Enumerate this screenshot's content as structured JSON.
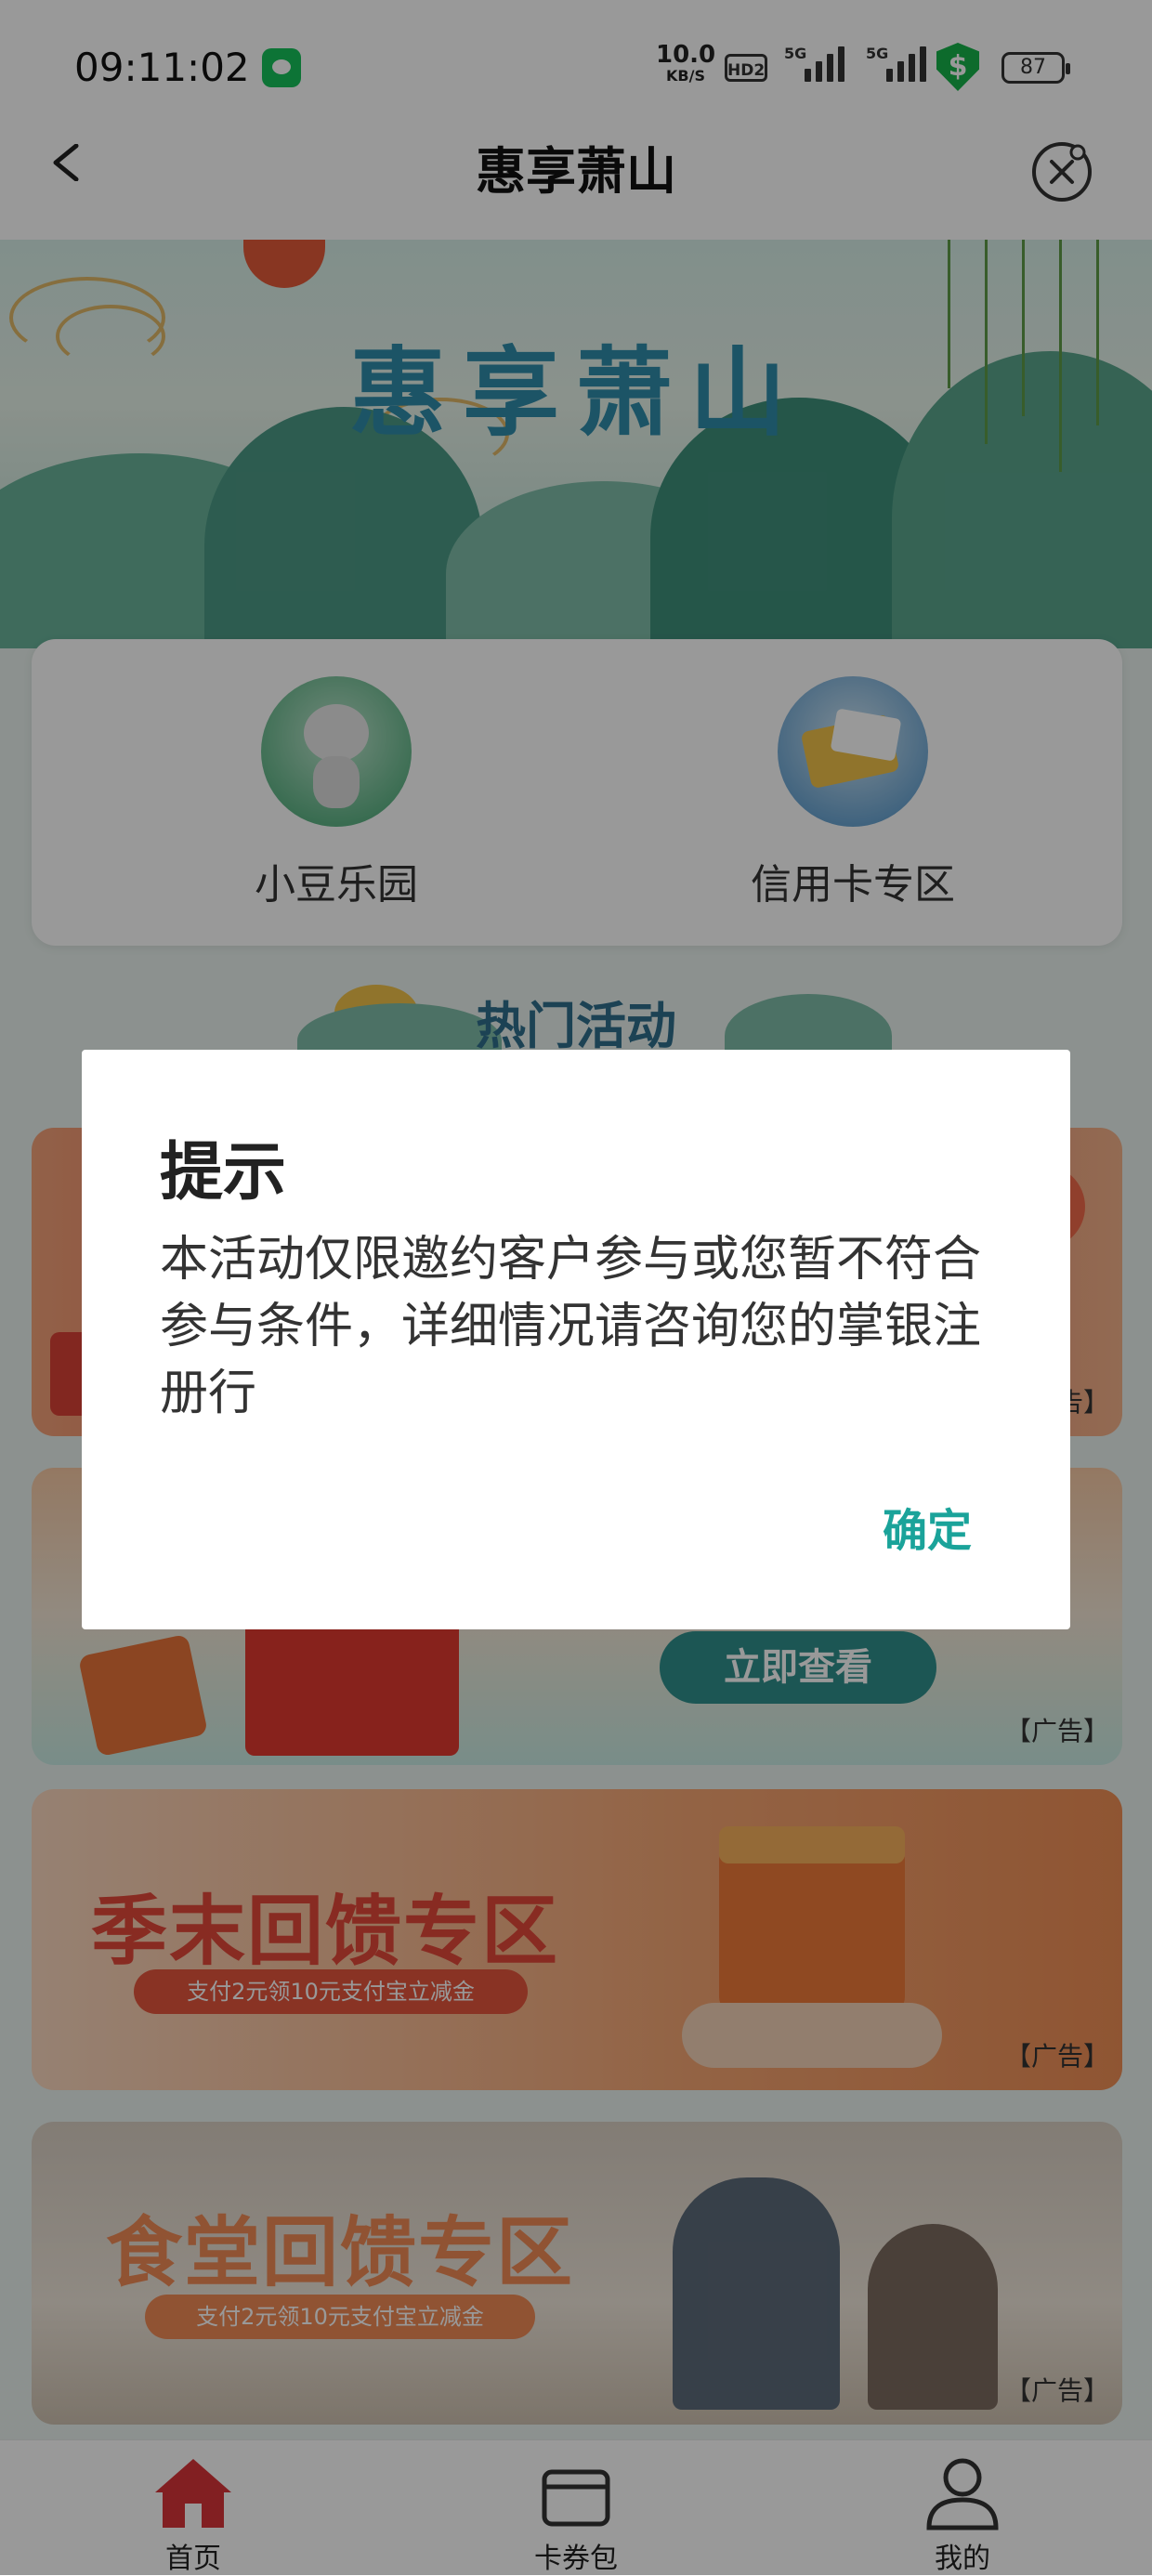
{
  "status_bar": {
    "time": "09:11:02",
    "net_speed_value": "10.0",
    "net_speed_unit": "KB/S",
    "hd_label": "HD2",
    "signal1_label": "5G",
    "signal2_label": "5G",
    "security_symbol": "$",
    "battery": "87"
  },
  "nav": {
    "title": "惠享萧山"
  },
  "banner": {
    "title": "惠享萧山"
  },
  "quick_entries": [
    {
      "label": "小豆乐园",
      "icon": "mascot-icon"
    },
    {
      "label": "信用卡专区",
      "icon": "credit-card-icon"
    }
  ],
  "hot_section": {
    "title": "热门活动"
  },
  "promos": [
    {
      "ad_tag": "【广告】"
    },
    {
      "button": "立即查看",
      "ad_tag": "【广告】"
    },
    {
      "title": "季末回馈专区",
      "subtitle": "支付2元领10元支付宝立减金",
      "ad_tag": "【广告】"
    },
    {
      "title": "食堂回馈专区",
      "subtitle": "支付2元领10元支付宝立减金",
      "ad_tag": "【广告】"
    }
  ],
  "tab_bar": {
    "items": [
      {
        "label": "首页",
        "icon": "home-icon",
        "active": true
      },
      {
        "label": "卡券包",
        "icon": "card-wallet-icon",
        "active": false
      },
      {
        "label": "我的",
        "icon": "user-icon",
        "active": false
      }
    ]
  },
  "dialog": {
    "title": "提示",
    "message": "本活动仅限邀约客户参与或您暂不符合参与条件，详细情况请咨询您的掌银注册行",
    "confirm_label": "确定"
  },
  "colors": {
    "accent": "#1aa39a",
    "home_active": "#d9353a",
    "banner_title": "#2f8cab"
  }
}
